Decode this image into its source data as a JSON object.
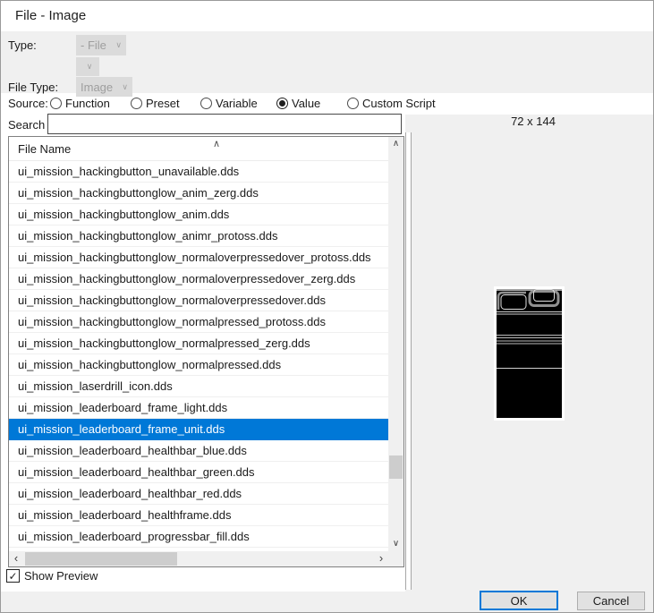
{
  "window": {
    "title": "File - Image"
  },
  "properties": {
    "type": {
      "label": "Type:",
      "value": "- File"
    },
    "sub_type": {
      "value": ""
    },
    "file_type": {
      "label": "File Type:",
      "value": "Image"
    },
    "source": {
      "label": "Source:",
      "options": [
        "Function",
        "Preset",
        "Variable",
        "Value",
        "Custom Script"
      ],
      "selected": "Value"
    },
    "search": {
      "label": "Search",
      "value": ""
    }
  },
  "file_list": {
    "header": "File Name",
    "selected": "ui_mission_leaderboard_frame_unit.dds",
    "items": [
      "ui_mission_hackingbutton_unavailable.dds",
      "ui_mission_hackingbuttonglow_anim_zerg.dds",
      "ui_mission_hackingbuttonglow_anim.dds",
      "ui_mission_hackingbuttonglow_animr_protoss.dds",
      "ui_mission_hackingbuttonglow_normaloverpressedover_protoss.dds",
      "ui_mission_hackingbuttonglow_normaloverpressedover_zerg.dds",
      "ui_mission_hackingbuttonglow_normaloverpressedover.dds",
      "ui_mission_hackingbuttonglow_normalpressed_protoss.dds",
      "ui_mission_hackingbuttonglow_normalpressed_zerg.dds",
      "ui_mission_hackingbuttonglow_normalpressed.dds",
      "ui_mission_laserdrill_icon.dds",
      "ui_mission_leaderboard_frame_light.dds",
      "ui_mission_leaderboard_frame_unit.dds",
      "ui_mission_leaderboard_healthbar_blue.dds",
      "ui_mission_leaderboard_healthbar_green.dds",
      "ui_mission_leaderboard_healthbar_red.dds",
      "ui_mission_leaderboard_healthframe.dds",
      "ui_mission_leaderboard_progressbar_fill.dds"
    ]
  },
  "preview": {
    "size_label": "72 x 144"
  },
  "footer": {
    "show_preview_label": "Show Preview",
    "show_preview_checked": true,
    "ok_label": "OK",
    "cancel_label": "Cancel"
  },
  "icons": {
    "chevron_down": "∨",
    "sort_asc": "∧",
    "scroll_up": "∧",
    "scroll_down": "∨",
    "scroll_left": "‹",
    "scroll_right": "›",
    "checkmark": "✓"
  },
  "colors": {
    "selection_blue": "#0078d7",
    "panel_gray": "#f0f0f0",
    "combo_gray": "#dbdbdb",
    "disabled_text": "#9e9e9e",
    "ok_focus_border": "#0078d7"
  }
}
